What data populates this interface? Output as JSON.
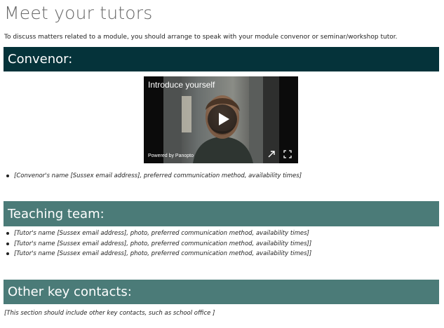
{
  "page": {
    "title": "Meet your tutors",
    "intro": "To discuss matters related to a module, you should arrange to speak with your module convenor or seminar/workshop tutor."
  },
  "colors": {
    "convenor_banner": "#05333a",
    "teaching_banner": "#4b7b78",
    "other_banner": "#4b7b78",
    "title_text": "#666666"
  },
  "sections": {
    "convenor": {
      "heading": "Convenor:",
      "video": {
        "title": "Introduce yourself",
        "powered_by": "Powered by Panopto",
        "controls": [
          "play-icon",
          "expand-icon",
          "fullscreen-icon"
        ]
      },
      "items": [
        "[Convenor's name [Sussex email address], preferred communication method, availability times]"
      ]
    },
    "teaching": {
      "heading": "Teaching team:",
      "items": [
        "[Tutor's name [Sussex email address], photo, preferred communication method, availability times]",
        "[Tutor's name [Sussex email address], photo, preferred communication method, availability times]]",
        "[Tutor's name [Sussex email address], photo, preferred communication method, availability times]]"
      ]
    },
    "other": {
      "heading": "Other key contacts:",
      "note": "[This section should include other key contacts, such as school office ]"
    }
  }
}
